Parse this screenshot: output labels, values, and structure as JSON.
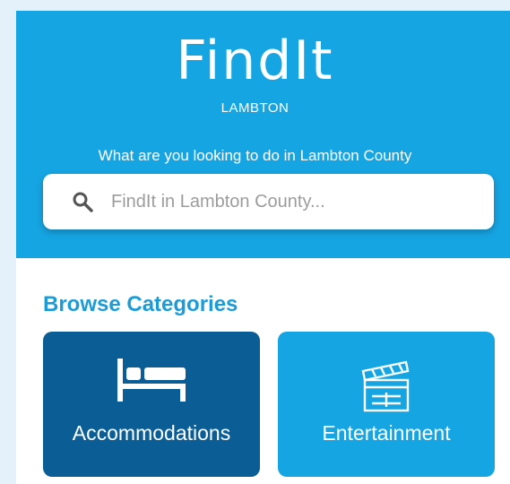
{
  "header": {
    "logo_text": "FindIt",
    "logo_subtitle": "LAMBTON",
    "prompt": "What are you looking to do in Lambton County"
  },
  "search": {
    "placeholder": "FindIt in Lambton County...",
    "icon": "search-icon"
  },
  "browse": {
    "title": "Browse Categories",
    "categories": [
      {
        "label": "Accommodations",
        "icon": "bed-icon",
        "color": "#0b5e95"
      },
      {
        "label": "Entertainment",
        "icon": "clapperboard-icon",
        "color": "#16a5e3"
      }
    ]
  },
  "colors": {
    "brand": "#16a5e3",
    "accent_dark": "#0b5e95",
    "heading": "#1a9cd9"
  }
}
